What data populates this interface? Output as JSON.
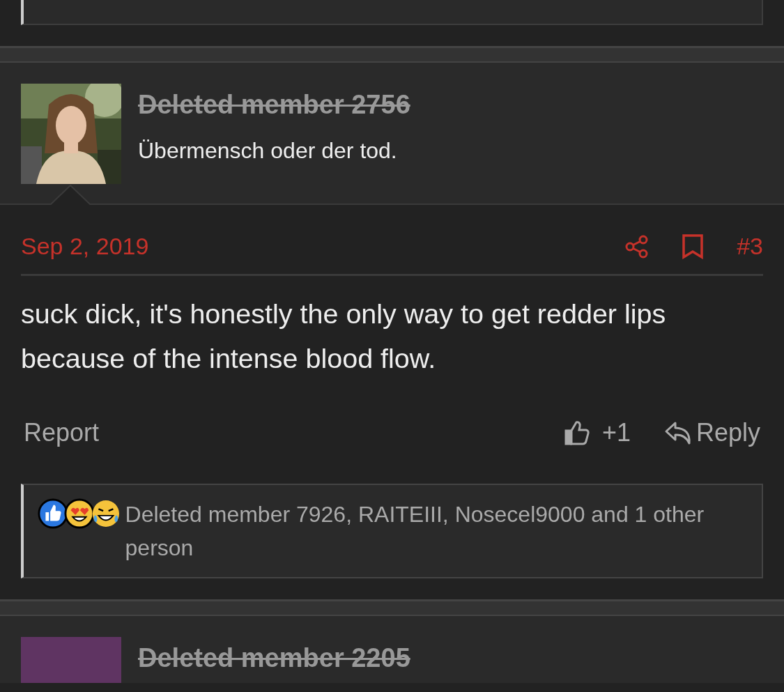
{
  "posts": [
    {
      "author": "Deleted member 2756",
      "deleted": true,
      "signature": "Übermensch oder der tod.",
      "date": "Sep 2, 2019",
      "number": "#3",
      "message": "suck dick, it's honestly the only way to get redder lips because of the intense blood flow.",
      "report": "Report",
      "like_count": "+1",
      "reply": "Reply",
      "reactions": [
        {
          "kind": "like"
        },
        {
          "kind": "love"
        },
        {
          "kind": "haha"
        }
      ],
      "reaction_text": "Deleted member 7926, RAITEIII, Nosecel9000 and 1 other person"
    },
    {
      "author": "Deleted member 2205",
      "deleted": true,
      "avatar": {
        "kind": "letter",
        "color": "#5f3462"
      }
    }
  ]
}
